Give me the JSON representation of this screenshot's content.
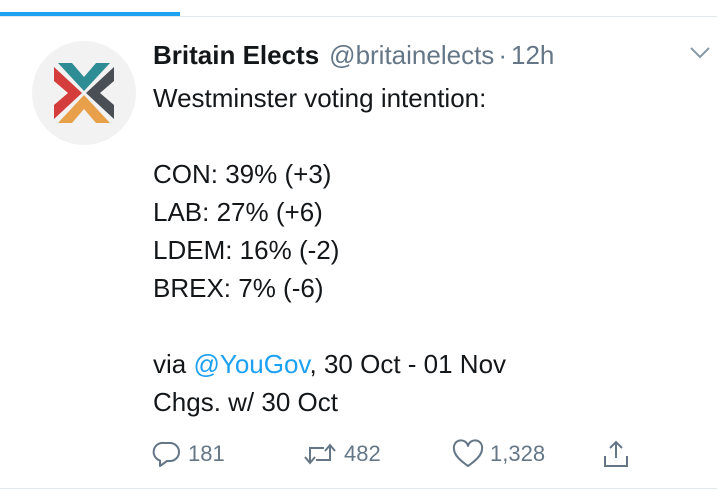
{
  "tweet": {
    "author_name": "Britain Elects",
    "handle": "@britainelects",
    "separator": "·",
    "time": "12h",
    "lines": {
      "l1": "Westminster voting intention:",
      "l2": "CON: 39% (+3)",
      "l3": "LAB: 27% (+6)",
      "l4": "LDEM: 16% (-2)",
      "l5": "BREX: 7% (-6)",
      "via_prefix": "via ",
      "mention": "@YouGov",
      "via_suffix": ", 30 Oct - 01 Nov",
      "l7": "Chgs. w/ 30 Oct"
    }
  },
  "actions": {
    "replies": "181",
    "retweets": "482",
    "likes": "1,328"
  },
  "icons": {
    "avatar_logo": "britain-elects-logo",
    "caret": "chevron-down-icon",
    "reply": "reply-icon",
    "retweet": "retweet-icon",
    "like": "heart-icon",
    "share": "share-icon"
  },
  "colors": {
    "accent": "#1da1f2",
    "muted": "#657786",
    "text": "#14171a",
    "logo_teal": "#2e8c94",
    "logo_red": "#d43d3b",
    "logo_orange": "#e8a04a",
    "logo_gray": "#4a4f55"
  }
}
